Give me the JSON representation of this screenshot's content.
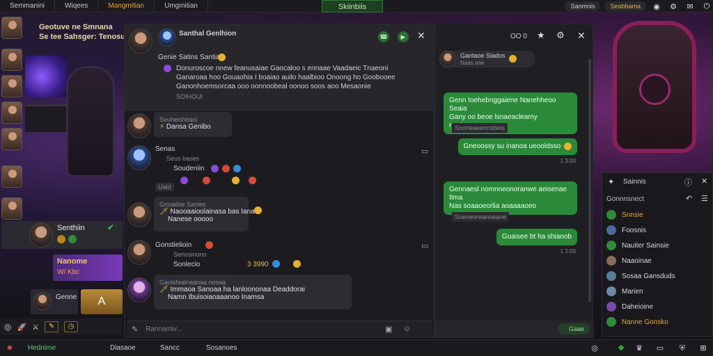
{
  "topbar": {
    "tabs": [
      "Semmanini",
      "Wiqees",
      "Mangmitian",
      "Umgmitian"
    ],
    "center_tab": "Skiinbiis",
    "pill_left": "Sanmnis",
    "pill_gold": "Seabbama"
  },
  "left": {
    "header_line1": "Geotuve ne Smnana",
    "header_line2": "Se tee Sahsger: Tenosu",
    "selected_friend": "Senthiin",
    "purple_title": "Nanome",
    "purple_sub": "W/ Kbc",
    "small_card": "Genne",
    "letter": "A"
  },
  "chat": {
    "header_name": "Santhal Genlhion",
    "first_name": "Genie Satins Santian",
    "msg1": "Donuroscoe nnew feanusaiae Gaocaloo s ennaae Vaadaeic Tnaeoni",
    "msg1b": "Ganaroaa hoo Gouaohia I boaiao auilo haalbioo Onoong ho Goobooee",
    "msg1c": "Ganonhoemsorcaa ooo oonnoobeal oonoo soos aoo Mesaonie",
    "msg1d": "SOIHOUI",
    "bubble1_name": "Seuheisheani",
    "bubble1": "Dansa Genibo",
    "user2_name": "Senas",
    "user2_sub": "Seus bases",
    "user2_line": "Soudeniin",
    "user2_tag": "Uaid",
    "bubble3_name": "Gnsadoe Sanies",
    "bubble3": "Naooaaioolainasa bas Ianaa",
    "bubble3b": "Nanese ooooo",
    "user4_name": "Gonstielioin",
    "user4_sub": "Senosinono",
    "user4_line": "Sonlecio",
    "user4_num": "3 3990",
    "bubble5_name": "Gaolsfaalnaanaa nosaa",
    "bubble5": "Immaoa Sanoaa ha lanloononaa Deaddorai",
    "bubble5b": "Namn Ibuisoiaoaaanoo Inamsa",
    "input_placeholder": "Rannamiv..."
  },
  "dm": {
    "count": "OO 0",
    "header_name": "Gantaoe Slados",
    "header_sub": "Naas ane",
    "g1": "Genn Ioehebnggaiene Nanehheoo Seaia",
    "g1b": "Gany oo beoe lsnaeacleamy nneineosseeo",
    "t1": "Snoneaeeomibeis",
    "g2": "Gneoossy su inanoa ueooldsso",
    "t2": "1 3:03",
    "g3": "Gennaesl nomnneonoranwe aeisenae Itma",
    "g3b": "Nas soaaoeorlia aoaaaaoeo",
    "t3": "Sneneoreanoeane",
    "g4": "Guaisee bt ha shianob",
    "t4": "1 2:03",
    "send": "Gaae"
  },
  "friends": {
    "title": "Sainnis",
    "section": "Gonnnsnect",
    "items": [
      {
        "label": "Snnsie",
        "color": "#e6a83a"
      },
      {
        "label": "Foosnis",
        "color": "#d0d0d4"
      },
      {
        "label": "Nauiter Sainsie",
        "color": "#d0d0d4"
      },
      {
        "label": "Naaoinae",
        "color": "#d0d0d4"
      },
      {
        "label": "Sosaa Gansduds",
        "color": "#d0d0d4"
      },
      {
        "label": "Marien",
        "color": "#d0d0d4"
      },
      {
        "label": "Daheioine",
        "color": "#d0d0d4"
      },
      {
        "label": "Nanne Gonsko",
        "color": "#e6a83a"
      }
    ]
  },
  "taskbar": {
    "item1": "Hednime",
    "item2": "Diasaoe",
    "item3": "Sancc",
    "item4": "Sosanoes"
  }
}
